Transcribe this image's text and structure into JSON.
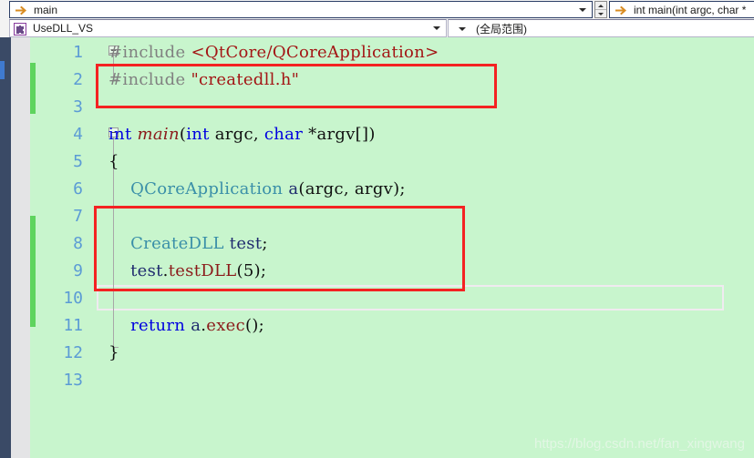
{
  "navbar": {
    "row1": {
      "member_combo": {
        "icon": "arrow-right-icon",
        "value": "main",
        "caret": "chevron-down-icon"
      },
      "spinner": {
        "up": "spin-up-icon",
        "down": "spin-down-icon"
      },
      "signature_combo": {
        "icon": "arrow-right-icon",
        "value": "int main(int argc, char *"
      }
    },
    "row2": {
      "project_combo": {
        "icon": "project-puzzle-icon",
        "value": "UseDLL_VS",
        "caret": "chevron-down-icon"
      },
      "scope_combo": {
        "caret": "chevron-down-icon",
        "value": "(全局范围)"
      }
    }
  },
  "editor": {
    "background_color": "#c8f5cd",
    "line_number_color": "#5b9bd5",
    "change_bar_color": "#5ed45e",
    "annotation_color": "#f42222",
    "lines": [
      {
        "number": "1",
        "tokens": [
          {
            "t": "#include ",
            "c": "pp"
          },
          {
            "t": "<QtCore/QCoreApplication>",
            "c": "str"
          }
        ]
      },
      {
        "number": "2",
        "tokens": [
          {
            "t": "#include ",
            "c": "pp"
          },
          {
            "t": "\"createdll.h\"",
            "c": "str"
          }
        ]
      },
      {
        "number": "3",
        "tokens": []
      },
      {
        "number": "4",
        "tokens": [
          {
            "t": "int ",
            "c": "kw"
          },
          {
            "t": "main",
            "c": "fnc-it"
          },
          {
            "t": "(",
            "c": "punc"
          },
          {
            "t": "int",
            "c": "kw"
          },
          {
            "t": " argc, ",
            "c": "punc"
          },
          {
            "t": "char",
            "c": "kw"
          },
          {
            "t": " *argv[])",
            "c": "punc"
          }
        ]
      },
      {
        "number": "5",
        "tokens": [
          {
            "t": "{",
            "c": "punc"
          }
        ]
      },
      {
        "number": "6",
        "tokens": [
          {
            "t": "    QCoreApplication",
            "c": "type"
          },
          {
            "t": " a",
            "c": "var"
          },
          {
            "t": "(argc, argv);",
            "c": "punc"
          }
        ]
      },
      {
        "number": "7",
        "tokens": []
      },
      {
        "number": "8",
        "tokens": [
          {
            "t": "    CreateDLL",
            "c": "type"
          },
          {
            "t": " test",
            "c": "var"
          },
          {
            "t": ";",
            "c": "punc"
          }
        ]
      },
      {
        "number": "9",
        "tokens": [
          {
            "t": "    test",
            "c": "var"
          },
          {
            "t": ".",
            "c": "punc"
          },
          {
            "t": "testDLL",
            "c": "fnc"
          },
          {
            "t": "(",
            "c": "punc"
          },
          {
            "t": "5",
            "c": "num"
          },
          {
            "t": ");",
            "c": "punc"
          }
        ]
      },
      {
        "number": "10",
        "tokens": []
      },
      {
        "number": "11",
        "tokens": [
          {
            "t": "    return",
            "c": "kw"
          },
          {
            "t": " a",
            "c": "var"
          },
          {
            "t": ".",
            "c": "punc"
          },
          {
            "t": "exec",
            "c": "fnc"
          },
          {
            "t": "();",
            "c": "punc"
          }
        ]
      },
      {
        "number": "12",
        "tokens": [
          {
            "t": "}",
            "c": "punc"
          }
        ]
      },
      {
        "number": "13",
        "tokens": []
      }
    ],
    "current_line": "10"
  },
  "watermark": {
    "text": "https://blog.csdn.net/fan_xingwang"
  }
}
